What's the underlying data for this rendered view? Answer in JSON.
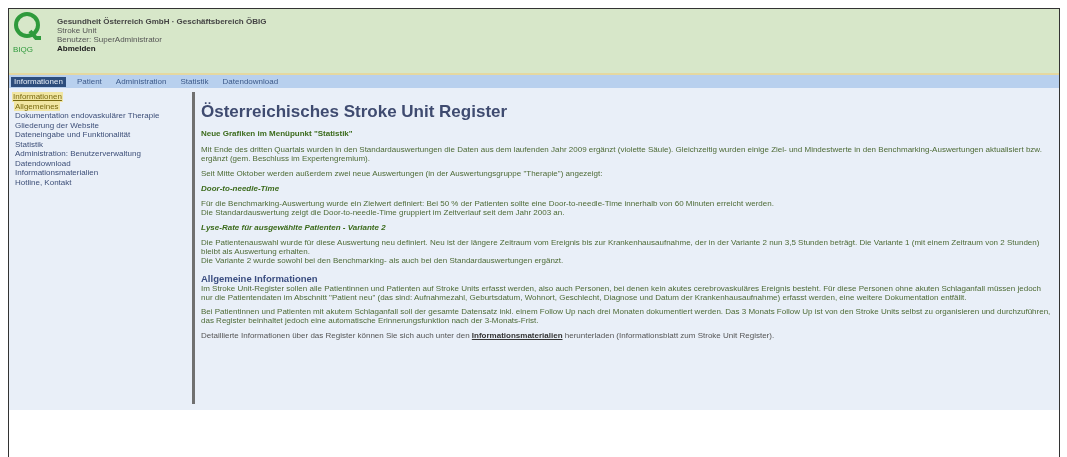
{
  "header": {
    "logo_text": "BIQG",
    "organization": "Gesundheit Österreich GmbH · Geschäftsbereich ÖBIG",
    "application": "Stroke Unit",
    "user": "Benutzer: SuperAdministrator",
    "logout": "Abmelden"
  },
  "nav": [
    {
      "label": "Informationen",
      "selected": true
    },
    {
      "label": "Patient",
      "selected": false
    },
    {
      "label": "Administration",
      "selected": false
    },
    {
      "label": "Statistik",
      "selected": false
    },
    {
      "label": "Datendownload",
      "selected": false
    }
  ],
  "sidebar": {
    "items": [
      {
        "label": "Informationen",
        "selected": true,
        "children": [
          {
            "label": "Allgemeines",
            "selected": true
          },
          {
            "label": "Dokumentation endovaskulärer Therapie",
            "selected": false
          },
          {
            "label": "Gliederung der Website",
            "selected": false
          },
          {
            "label": "Dateneingabe und Funktionalität",
            "selected": false
          },
          {
            "label": "Statistik",
            "selected": false
          },
          {
            "label": "Administration: Benutzerverwaltung",
            "selected": false
          },
          {
            "label": "Datendownload",
            "selected": false
          },
          {
            "label": "Informationsmaterialien",
            "selected": false
          },
          {
            "label": "Hotline, Kontakt",
            "selected": false
          }
        ]
      }
    ]
  },
  "content": {
    "title": "Österreichisches Stroke Unit Register",
    "blocks": [
      {
        "kind": "heading",
        "text": "Neue Grafiken im Menüpunkt \"Statistik\""
      },
      {
        "kind": "text",
        "lines": [
          "Mit Ende des dritten Quartals wurden in den Standardauswertungen die Daten aus dem laufenden Jahr 2009 ergänzt (violette Säule). Gleichzeitig wurden einige Ziel- und Mindestwerte in den Benchmarking-Auswertungen aktualisiert bzw. ergänzt (gem. Beschluss im Expertengremium)."
        ]
      },
      {
        "kind": "text",
        "lines": [
          "Seit Mitte Oktober werden außerdem zwei neue Auswertungen (in der Auswertungsgruppe \"Therapie\") angezeigt:"
        ]
      },
      {
        "kind": "subheading",
        "text": "Door-to-needle-Time"
      },
      {
        "kind": "text",
        "lines": [
          "Für die Benchmarking-Auswertung wurde ein Zielwert definiert: Bei 50 % der Patienten sollte eine Door-to-needle-Time innerhalb von 60 Minuten erreicht werden.",
          "Die Standardauswertung zeigt die Door-to-needle-Time gruppiert im Zeitverlauf seit dem Jahr 2003 an."
        ]
      },
      {
        "kind": "subheading",
        "text": "Lyse-Rate für ausgewählte Patienten - Variante 2"
      },
      {
        "kind": "text",
        "lines": [
          "Die Patientenauswahl wurde für diese Auswertung neu definiert. Neu ist der längere Zeitraum vom Ereignis bis zur Krankenhausaufnahme, der in der Variante 2 nun 3,5 Stunden beträgt. Die Variante 1 (mit einem Zeitraum von 2 Stunden) bleibt als Auswertung erhalten.",
          "Die Variante 2 wurde sowohl bei den Benchmarking- als auch bei den Standardauswertungen ergänzt."
        ]
      },
      {
        "kind": "section",
        "text": "Allgemeine Informationen"
      },
      {
        "kind": "text",
        "lines": [
          "Im Stroke Unit-Register sollen alle Patientinnen und Patienten auf Stroke Units erfasst werden, also auch Personen, bei denen kein akutes cerebrovaskuläres Ereignis besteht. Für diese Personen ohne akuten Schlaganfall müssen jedoch nur die Patientendaten im Abschnitt \"Patient neu\" (das sind: Aufnahmezahl, Geburtsdatum, Wohnort, Geschlecht, Diagnose und Datum der Krankenhausaufnahme) erfasst werden, eine weitere Dokumentation entfällt."
        ]
      },
      {
        "kind": "text",
        "lines": [
          "Bei Patientinnen und Patienten mit akutem Schlaganfall soll der gesamte Datensatz inkl. einem Follow Up nach drei Monaten dokumentiert werden. Das 3 Monats Follow Up ist von den Stroke Units selbst zu organisieren und durchzuführen, das Register beinhaltet jedoch eine automatische Erinnerungsfunktion nach der 3-Monats-Frist."
        ]
      },
      {
        "kind": "link_text",
        "before": "Detaillierte Informationen über das Register können Sie sich auch unter den",
        "link": "Informationsmaterialien",
        "after": "herunterladen (Informationsblatt zum Stroke Unit Register)."
      }
    ]
  }
}
